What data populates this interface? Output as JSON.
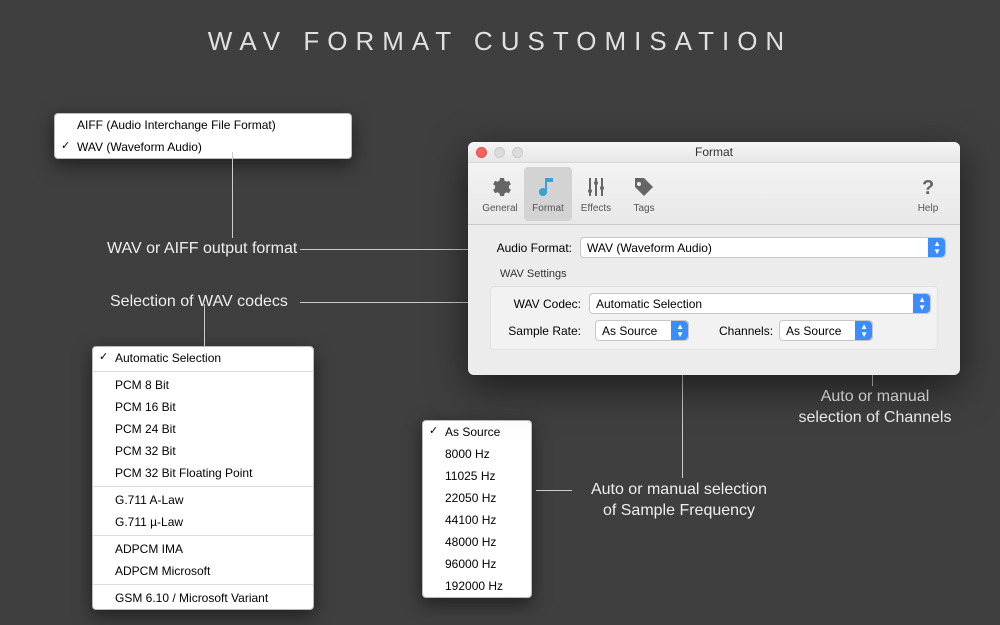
{
  "title": "WAV  FORMAT  CUSTOMISATION",
  "annotations": {
    "output_format": "WAV or AIFF output format",
    "codec_selection": "Selection of WAV codecs",
    "channels": "Auto or manual\nselection of Channels",
    "sample_freq": "Auto or manual selection\nof Sample Frequency"
  },
  "format_popup": {
    "items": [
      {
        "label": "AIFF (Audio Interchange File Format)",
        "checked": false
      },
      {
        "label": "WAV (Waveform Audio)",
        "checked": true
      }
    ]
  },
  "codec_popup": {
    "groups": [
      [
        {
          "label": "Automatic Selection",
          "checked": true
        }
      ],
      [
        {
          "label": "PCM 8 Bit"
        },
        {
          "label": "PCM 16 Bit"
        },
        {
          "label": "PCM 24 Bit"
        },
        {
          "label": "PCM 32 Bit"
        },
        {
          "label": "PCM 32 Bit Floating Point"
        }
      ],
      [
        {
          "label": "G.711 A-Law"
        },
        {
          "label": "G.711 µ-Law"
        }
      ],
      [
        {
          "label": "ADPCM IMA"
        },
        {
          "label": "ADPCM Microsoft"
        }
      ],
      [
        {
          "label": "GSM 6.10 / Microsoft Variant"
        }
      ]
    ]
  },
  "rate_popup": {
    "items": [
      {
        "label": "As Source",
        "checked": true
      },
      {
        "label": "8000 Hz"
      },
      {
        "label": "11025 Hz"
      },
      {
        "label": "22050 Hz"
      },
      {
        "label": "44100 Hz"
      },
      {
        "label": "48000 Hz"
      },
      {
        "label": "96000 Hz"
      },
      {
        "label": "192000 Hz"
      }
    ]
  },
  "window": {
    "title": "Format",
    "tabs": {
      "general": "General",
      "format": "Format",
      "effects": "Effects",
      "tags": "Tags",
      "help": "Help"
    },
    "form": {
      "audio_format_label": "Audio Format:",
      "audio_format_value": "WAV (Waveform Audio)",
      "section_title": "WAV Settings",
      "codec_label": "WAV Codec:",
      "codec_value": "Automatic Selection",
      "rate_label": "Sample Rate:",
      "rate_value": "As Source",
      "channels_label": "Channels:",
      "channels_value": "As Source"
    }
  }
}
